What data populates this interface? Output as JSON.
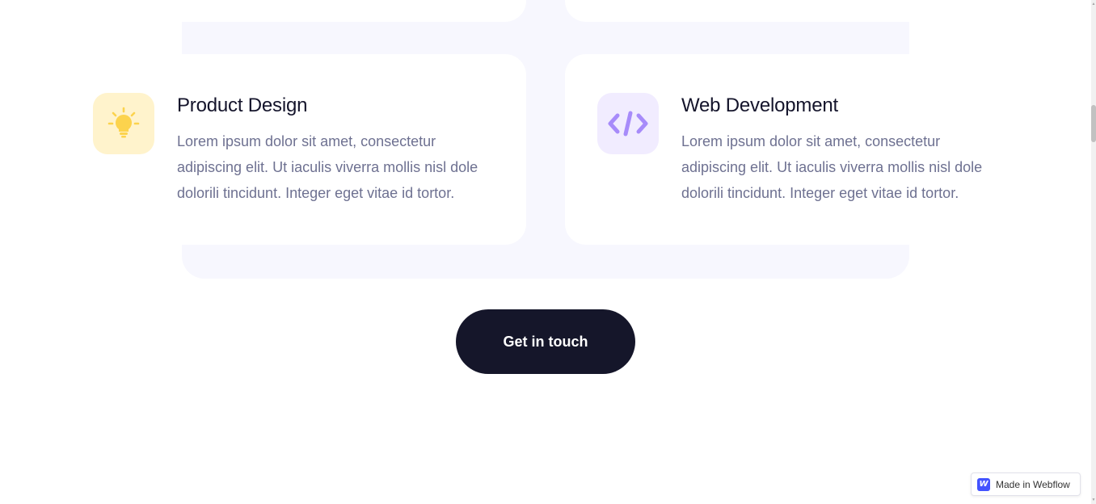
{
  "services": [
    {
      "icon": "lightbulb-icon",
      "title": "Product Design",
      "description": "Lorem ipsum dolor sit amet, consectetur adipiscing elit. Ut iaculis viverra mollis nisl dole dolorili tincidunt. Integer eget vitae id tortor."
    },
    {
      "icon": "code-icon",
      "title": "Web Development",
      "description": "Lorem ipsum dolor sit amet, consectetur adipiscing elit. Ut iaculis viverra mollis nisl dole dolorili tincidunt. Integer eget vitae id tortor."
    }
  ],
  "cta": {
    "label": "Get in touch"
  },
  "badge": {
    "logo": "W",
    "label": "Made in Webflow"
  },
  "colors": {
    "accent_yellow": "#fcd34d",
    "accent_purple": "#a78bfa",
    "dark": "#15162a",
    "text_muted": "#6e7191"
  }
}
